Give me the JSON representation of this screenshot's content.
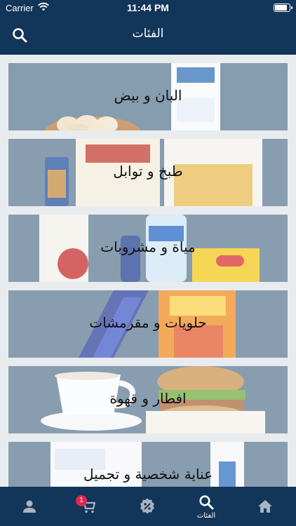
{
  "status_bar": {
    "carrier": "Carrier",
    "time": "11:44 PM",
    "battery_level": 0.92
  },
  "header": {
    "title": "الفئات",
    "search_icon": "search-icon"
  },
  "categories": [
    {
      "label": "البان و بيض"
    },
    {
      "label": "طبخ و توابل"
    },
    {
      "label": "مياة و مشروبات"
    },
    {
      "label": "حلويات و مقرمشات"
    },
    {
      "label": "افطار و قهوة"
    },
    {
      "label": "عناية شخصية و تجميل"
    }
  ],
  "tabbar": {
    "items": [
      {
        "icon": "person-icon",
        "label": ""
      },
      {
        "icon": "cart-icon",
        "label": "",
        "badge": "1"
      },
      {
        "icon": "discount-icon",
        "label": ""
      },
      {
        "icon": "search-icon",
        "label": "الفئات",
        "active": true
      },
      {
        "icon": "home-icon",
        "label": ""
      }
    ]
  },
  "colors": {
    "primary": "#12355a",
    "badge": "#e0284c",
    "card_bg": "#5f7d95"
  }
}
